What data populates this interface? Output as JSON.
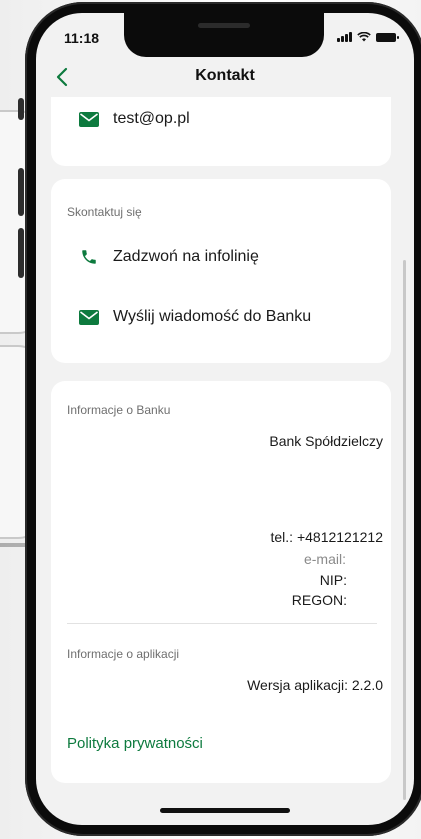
{
  "status_bar": {
    "time": "11:18"
  },
  "nav": {
    "title": "Kontakt",
    "back_icon": "chevron-left-icon"
  },
  "email_card": {
    "email": "test@op.pl",
    "icon": "envelope-icon"
  },
  "contact_card": {
    "title": "Skontaktuj się",
    "items": [
      {
        "label": "Zadzwoń na infolinię",
        "icon": "phone-icon"
      },
      {
        "label": "Wyślij wiadomość do Banku",
        "icon": "envelope-icon"
      }
    ]
  },
  "bank_info": {
    "title": "Informacje o Banku",
    "name": "Bank Spółdzielczy",
    "phone": "tel.: +4812121212",
    "email_label": "e-mail:",
    "nip_label": "NIP:",
    "regon_label": "REGON:"
  },
  "app_info": {
    "title": "Informacje o aplikacji",
    "version": "Wersja aplikacji: 2.2.0"
  },
  "privacy": {
    "label": "Polityka prywatności"
  },
  "colors": {
    "accent": "#0d7a3e",
    "background": "#f2f2f2",
    "card": "#ffffff"
  }
}
